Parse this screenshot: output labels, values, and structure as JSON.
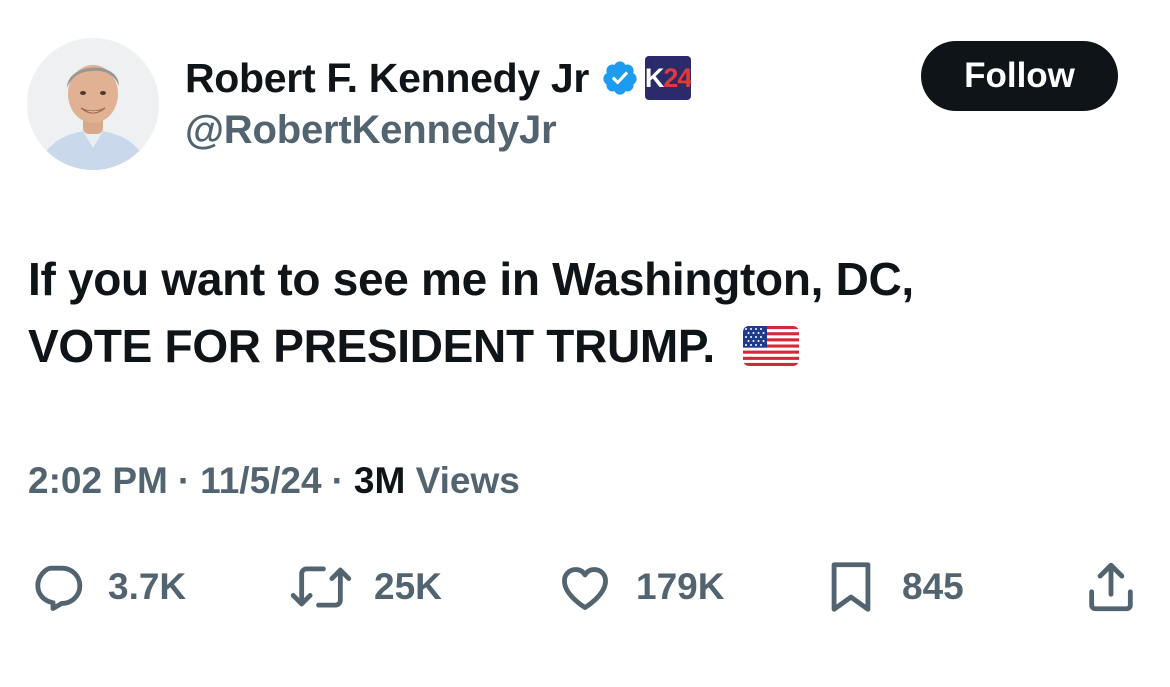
{
  "author": {
    "display_name": "Robert F. Kennedy Jr",
    "handle": "@RobertKennedyJr",
    "badge_text_1": "K",
    "badge_text_2": "24"
  },
  "follow_label": "Follow",
  "tweet": {
    "line1": "If you want to see me in Washington, DC,",
    "line2": "VOTE FOR PRESIDENT TRUMP."
  },
  "meta": {
    "time": "2:02 PM",
    "date": "11/5/24",
    "views_count": "3M",
    "views_label": "Views",
    "separator": "·"
  },
  "actions": {
    "replies": "3.7K",
    "reposts": "25K",
    "likes": "179K",
    "bookmarks": "845"
  },
  "colors": {
    "text": "#0f1419",
    "secondary": "#536471",
    "verified": "#1d9bf0",
    "follow_bg": "#0f1419"
  },
  "icons": {
    "avatar": "profile-photo",
    "verified": "verified-check-icon",
    "affiliate": "k24-affiliate-badge",
    "flag": "us-flag-emoji",
    "reply": "reply-bubble-icon",
    "repost": "repost-arrows-icon",
    "like": "heart-icon",
    "bookmark": "bookmark-icon",
    "share": "share-upload-icon"
  }
}
